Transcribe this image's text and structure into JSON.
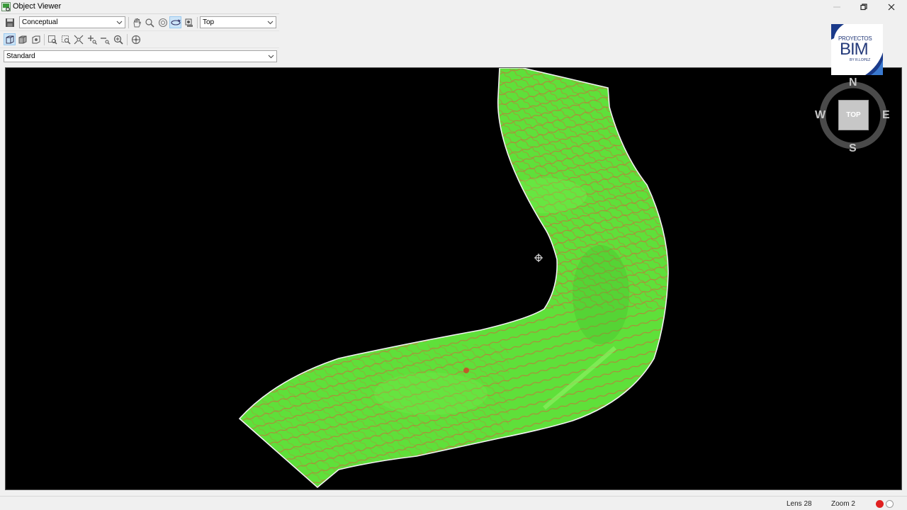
{
  "window": {
    "title": "Object Viewer",
    "icon": "object-viewer-icon"
  },
  "toolbar1": {
    "visual_style": "Conceptual",
    "view_direction": "Top",
    "tools": [
      "save-icon",
      "pan-icon",
      "zoom-icon",
      "orbit-icon",
      "free-orbit-icon",
      "continuous-orbit-icon",
      "camera-icon"
    ]
  },
  "toolbar2": {
    "tools": [
      "box-view-icon",
      "shaded-view-icon",
      "camera-view-icon",
      "zoom-window-icon",
      "zoom-extents-icon",
      "zoom-object-icon",
      "zoom-in-icon",
      "zoom-out-icon",
      "zoom-realtime-icon",
      "steering-wheel-icon"
    ]
  },
  "style_select": {
    "value": "Standard"
  },
  "logo": {
    "line1": "PROYECTOS",
    "line2": "BIM",
    "line3": "BY R.LOPEZ"
  },
  "viewcube": {
    "north": "N",
    "south": "S",
    "east": "E",
    "west": "W",
    "face": "TOP"
  },
  "status": {
    "lens": "Lens 28",
    "zoom": "Zoom 2"
  },
  "colors": {
    "surface": "#5fe03a",
    "contour": "#c07a3a",
    "viewport_bg": "#000000",
    "indicator_red": "#e02020"
  }
}
